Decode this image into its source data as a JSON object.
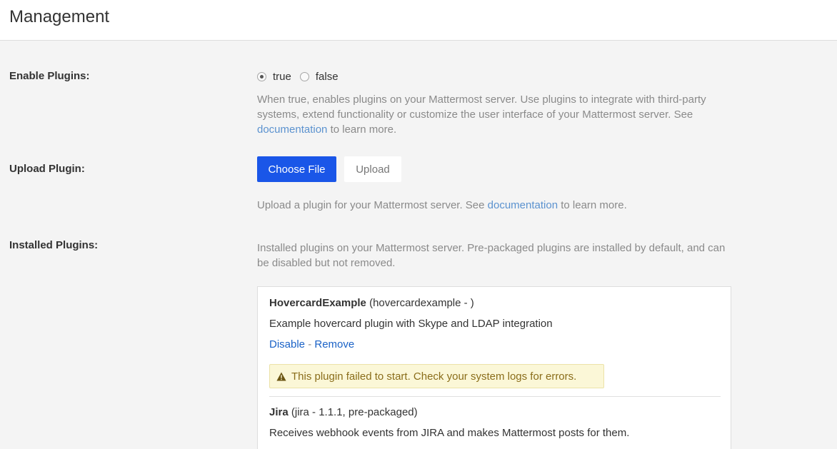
{
  "header": {
    "title": "Management"
  },
  "enable_plugins": {
    "label": "Enable Plugins:",
    "options": [
      "true",
      "false"
    ],
    "selected": "true",
    "help_before": "When true, enables plugins on your Mattermost server. Use plugins to integrate with third-party systems, extend functionality or customize the user interface of your Mattermost server. See ",
    "help_link": "documentation",
    "help_after": " to learn more."
  },
  "upload_plugin": {
    "label": "Upload Plugin:",
    "choose_file_label": "Choose File",
    "upload_label": "Upload",
    "help_before": "Upload a plugin for your Mattermost server. See ",
    "help_link": "documentation",
    "help_after": " to learn more."
  },
  "installed_plugins": {
    "label": "Installed Plugins:",
    "help": "Installed plugins on your Mattermost server. Pre-packaged plugins are installed by default, and can be disabled but not removed.",
    "plugins": [
      {
        "name": "HovercardExample",
        "meta": " (hovercardexample - )",
        "description": "Example hovercard plugin with Skype and LDAP integration",
        "disable_label": "Disable",
        "separator": " - ",
        "remove_label": "Remove",
        "warning": "This plugin failed to start. Check your system logs for errors."
      },
      {
        "name": "Jira",
        "meta": " (jira - 1.1.1, pre-packaged)",
        "description": "Receives webhook events from JIRA and makes Mattermost posts for them."
      }
    ]
  },
  "colors": {
    "primary_button": "#1a56e8",
    "link": "#5b92cf",
    "warning_bg": "#fbf7d7",
    "warning_text": "#8a6d1a"
  }
}
